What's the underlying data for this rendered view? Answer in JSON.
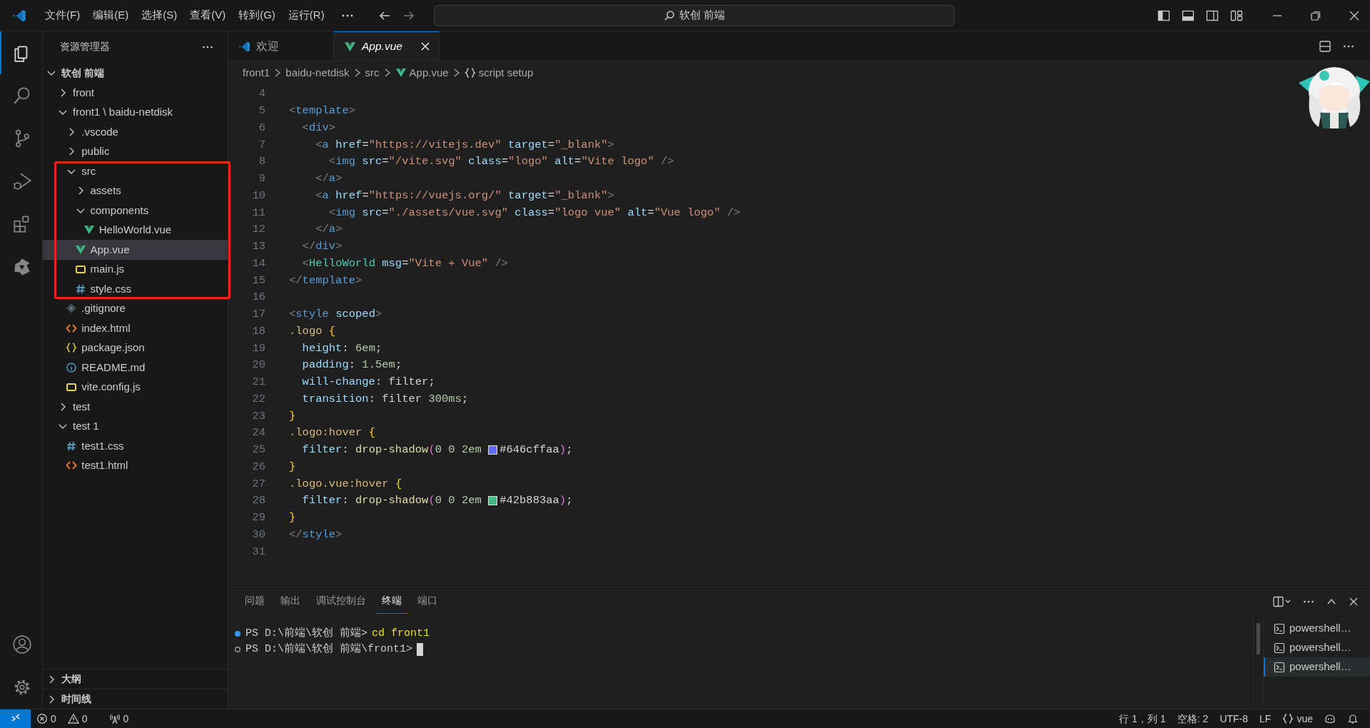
{
  "title_bar": {
    "menus": [
      "文件(F)",
      "编辑(E)",
      "选择(S)",
      "查看(V)",
      "转到(G)",
      "运行(R)"
    ],
    "search": {
      "value": "软创 前端"
    }
  },
  "activity_bar": [
    {
      "kind": "explorer",
      "selected": true
    },
    {
      "kind": "search",
      "selected": false
    },
    {
      "kind": "scm",
      "selected": false
    },
    {
      "kind": "debug",
      "selected": false
    },
    {
      "kind": "extensions",
      "selected": false
    },
    {
      "kind": "custom",
      "selected": false
    },
    {
      "kind": "account",
      "selected": false
    },
    {
      "kind": "settings",
      "selected": false
    }
  ],
  "explorer": {
    "title": "资源管理器",
    "sections": [
      {
        "label": "软创 前端",
        "expanded": true,
        "items": [
          {
            "label": "front",
            "kind": "folder",
            "expanded": false,
            "selected": false
          },
          {
            "label": "front1 \\ baidu-netdisk",
            "kind": "folder",
            "expanded": true,
            "selected": false,
            "children": [
              {
                "label": ".vscode",
                "kind": "folder",
                "expanded": false,
                "selected": false
              },
              {
                "label": "public",
                "kind": "folder",
                "expanded": false,
                "selected": false
              },
              {
                "label": "src",
                "kind": "folder",
                "expanded": true,
                "selected": false,
                "highlighted": true,
                "children": [
                  {
                    "label": "assets",
                    "kind": "folder",
                    "expanded": false,
                    "selected": false
                  },
                  {
                    "label": "components",
                    "kind": "folder",
                    "expanded": true,
                    "selected": false,
                    "children": [
                      {
                        "label": "HelloWorld.vue",
                        "kind": "vue",
                        "selected": false
                      }
                    ]
                  },
                  {
                    "label": "App.vue",
                    "kind": "vue",
                    "selected": true
                  },
                  {
                    "label": "main.js",
                    "kind": "js",
                    "selected": false
                  },
                  {
                    "label": "style.css",
                    "kind": "css",
                    "selected": false
                  }
                ]
              },
              {
                "label": ".gitignore",
                "kind": "git",
                "selected": false
              },
              {
                "label": "index.html",
                "kind": "html",
                "selected": false
              },
              {
                "label": "package.json",
                "kind": "json",
                "selected": false
              },
              {
                "label": "README.md",
                "kind": "info",
                "selected": false
              },
              {
                "label": "vite.config.js",
                "kind": "js",
                "selected": false
              }
            ]
          },
          {
            "label": "test",
            "kind": "folder",
            "expanded": false,
            "selected": false
          },
          {
            "label": "test 1",
            "kind": "folder",
            "expanded": true,
            "selected": false,
            "children": [
              {
                "label": "test1.css",
                "kind": "css",
                "selected": false
              },
              {
                "label": "test1.html",
                "kind": "html",
                "selected": false
              }
            ]
          }
        ]
      },
      {
        "label": "大纲",
        "expanded": false
      },
      {
        "label": "时间线",
        "expanded": false
      }
    ]
  },
  "tabs": [
    {
      "label": "欢迎",
      "kind": "welcome",
      "selected": false,
      "preview": false
    },
    {
      "label": "App.vue",
      "kind": "vue",
      "selected": true,
      "preview": true
    }
  ],
  "breadcrumbs": [
    {
      "label": "front1",
      "kind": "folder"
    },
    {
      "label": "baidu-netdisk",
      "kind": "folder"
    },
    {
      "label": "src",
      "kind": "folder"
    },
    {
      "label": "App.vue",
      "kind": "vue"
    },
    {
      "label": "script setup",
      "kind": "braces"
    }
  ],
  "code": [
    {
      "n": "4"
    },
    {
      "n": "5",
      "text": "<template>"
    },
    {
      "n": "6",
      "text": "  <div>"
    },
    {
      "n": "7",
      "text": "    <a href=\"https://vitejs.dev\" target=\"_blank\">"
    },
    {
      "n": "8",
      "text": "      <img src=\"/vite.svg\" class=\"logo\" alt=\"Vite logo\" />"
    },
    {
      "n": "9",
      "text": "    </a>"
    },
    {
      "n": "10",
      "text": "    <a href=\"https://vuejs.org/\" target=\"_blank\">"
    },
    {
      "n": "11",
      "text": "      <img src=\"./assets/vue.svg\" class=\"logo vue\" alt=\"Vue logo\" />"
    },
    {
      "n": "12",
      "text": "    </a>"
    },
    {
      "n": "13",
      "text": "  </div>"
    },
    {
      "n": "14",
      "text": "  <HelloWorld msg=\"Vite + Vue\" />"
    },
    {
      "n": "15",
      "text": "</template>"
    },
    {
      "n": "16"
    },
    {
      "n": "17",
      "text": "<style scoped>"
    },
    {
      "n": "18",
      "text": ".logo {"
    },
    {
      "n": "19",
      "text": "  height: 6em;"
    },
    {
      "n": "20",
      "text": "  padding: 1.5em;"
    },
    {
      "n": "21",
      "text": "  will-change: filter;"
    },
    {
      "n": "22",
      "text": "  transition: filter 300ms;"
    },
    {
      "n": "23",
      "text": "}"
    },
    {
      "n": "24",
      "text": ".logo:hover {"
    },
    {
      "n": "25",
      "text": "  filter: drop-shadow(0 0 2em",
      "swatch": {
        "color": "#646cff"
      },
      "text_after": "#646cffaa);"
    },
    {
      "n": "26",
      "text": "}"
    },
    {
      "n": "27",
      "text": ".logo.vue:hover {"
    },
    {
      "n": "28",
      "text": "  filter: drop-shadow(0 0 2em",
      "swatch": {
        "color": "#42b883"
      },
      "text_after": "#42b883aa);"
    },
    {
      "n": "29",
      "text": "}"
    },
    {
      "n": "30",
      "text": "</style>"
    },
    {
      "n": "31"
    }
  ],
  "panel": {
    "tabs": [
      {
        "label": "问题",
        "selected": false
      },
      {
        "label": "输出",
        "selected": false
      },
      {
        "label": "调试控制台",
        "selected": false
      },
      {
        "label": "终端",
        "selected": true
      },
      {
        "label": "端口",
        "selected": false
      }
    ],
    "terminal": {
      "lines": [
        {
          "done": true,
          "prompt": "PS D:\\前端\\软创 前端>",
          "command": "cd front1",
          "cursor": false
        },
        {
          "done": false,
          "prompt": "PS D:\\前端\\软创 前端\\front1>",
          "cursor": true
        }
      ],
      "instances": [
        {
          "label": "powershell…",
          "selected": false
        },
        {
          "label": "powershell…",
          "selected": false
        },
        {
          "label": "powershell…",
          "selected": true
        }
      ]
    }
  },
  "status_bar": {
    "left": [
      {
        "kind": "remote"
      },
      {
        "kind": "errors",
        "text": "0"
      },
      {
        "kind": "warnings",
        "text": "0"
      },
      {
        "kind": "ports",
        "text": "0"
      }
    ],
    "right": [
      {
        "kind": "text",
        "text": "行 1，列 1"
      },
      {
        "kind": "text",
        "text": "空格: 2"
      },
      {
        "kind": "text",
        "text": "UTF-8"
      },
      {
        "kind": "text",
        "text": "LF"
      },
      {
        "kind": "language",
        "text": "vue"
      },
      {
        "kind": "copilot"
      },
      {
        "kind": "bell"
      }
    ]
  }
}
